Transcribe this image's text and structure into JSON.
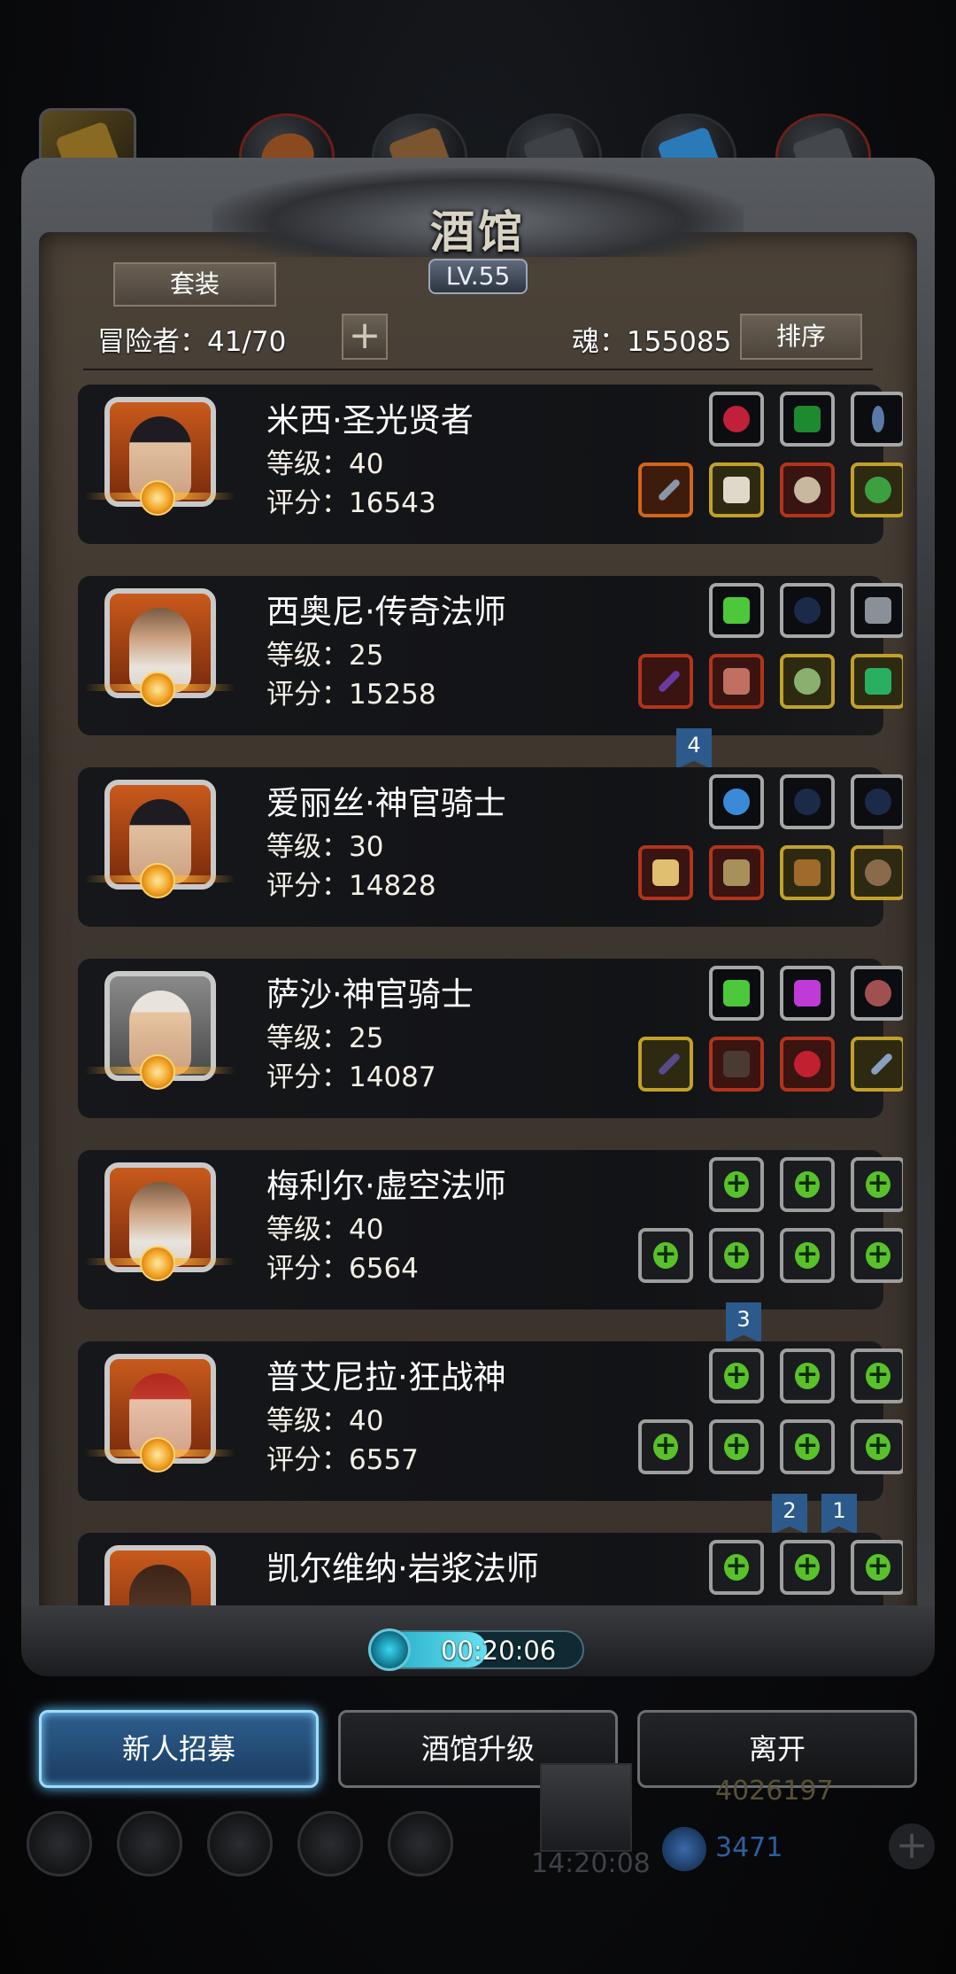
{
  "header": {
    "title": "酒馆",
    "level": "LV.55",
    "set_button": "套装",
    "adventurers": "冒险者：41/70",
    "add_symbol": "+",
    "souls": "魂：155085",
    "sort_button": "排序"
  },
  "heroes": [
    {
      "name": "米西·圣光贤者",
      "level": "等级：40",
      "score": "评分：16543",
      "portrait": "female-hood"
    },
    {
      "name": "西奥尼·传奇法师",
      "level": "等级：25",
      "score": "评分：15258",
      "portrait": "old-wizard"
    },
    {
      "name": "爱丽丝·神官骑士",
      "level": "等级：30",
      "score": "评分：14828",
      "portrait": "female-hood"
    },
    {
      "name": "萨沙·神官骑士",
      "level": "等级：25",
      "score": "评分：14087",
      "portrait": "female-helmet"
    },
    {
      "name": "梅利尔·虚空法师",
      "level": "等级：40",
      "score": "评分：6564",
      "portrait": "old-wizard"
    },
    {
      "name": "普艾尼拉·狂战神",
      "level": "等级：40",
      "score": "评分：6557",
      "portrait": "red-hair"
    },
    {
      "name": "凯尔维纳·岩浆法师",
      "level": "",
      "score": "",
      "portrait": "dark-man"
    }
  ],
  "badges": [
    "4",
    "3",
    "2",
    "1"
  ],
  "timer": {
    "text": "00:20:06",
    "progress": 0.55
  },
  "actions": {
    "recruit": "新人招募",
    "upgrade": "酒馆升级",
    "leave": "离开"
  },
  "footer": {
    "gold": "4026197",
    "gems": "3471",
    "time": "14:20:08"
  },
  "colors": {
    "accent": "#9fdcff",
    "slot_green_plus": "#59c12a",
    "badge_blue": "#2d5a8c"
  }
}
